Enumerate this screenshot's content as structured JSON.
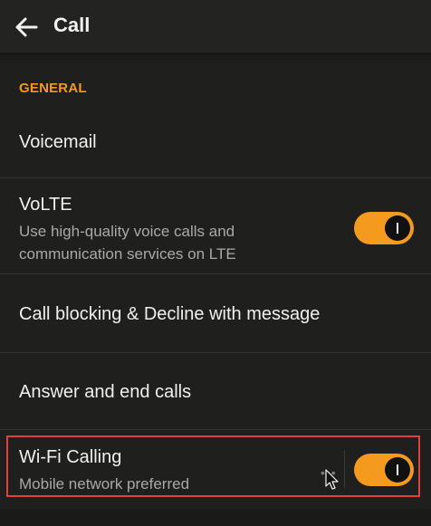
{
  "header": {
    "title": "Call",
    "back_icon": "arrow-left-icon"
  },
  "section": {
    "label": "GENERAL"
  },
  "items": [
    {
      "label": "Voicemail"
    },
    {
      "label": "VoLTE",
      "description": "Use high-quality voice calls and communication services on LTE",
      "toggle_on": true
    },
    {
      "label": "Call blocking & Decline with message"
    },
    {
      "label": "Answer and end calls"
    },
    {
      "label": "Wi-Fi Calling",
      "description": "Mobile network preferred",
      "toggle_on": true
    }
  ],
  "colors": {
    "accent": "#f39a1f",
    "highlight": "#e0413e",
    "background": "#1f1f1d"
  }
}
